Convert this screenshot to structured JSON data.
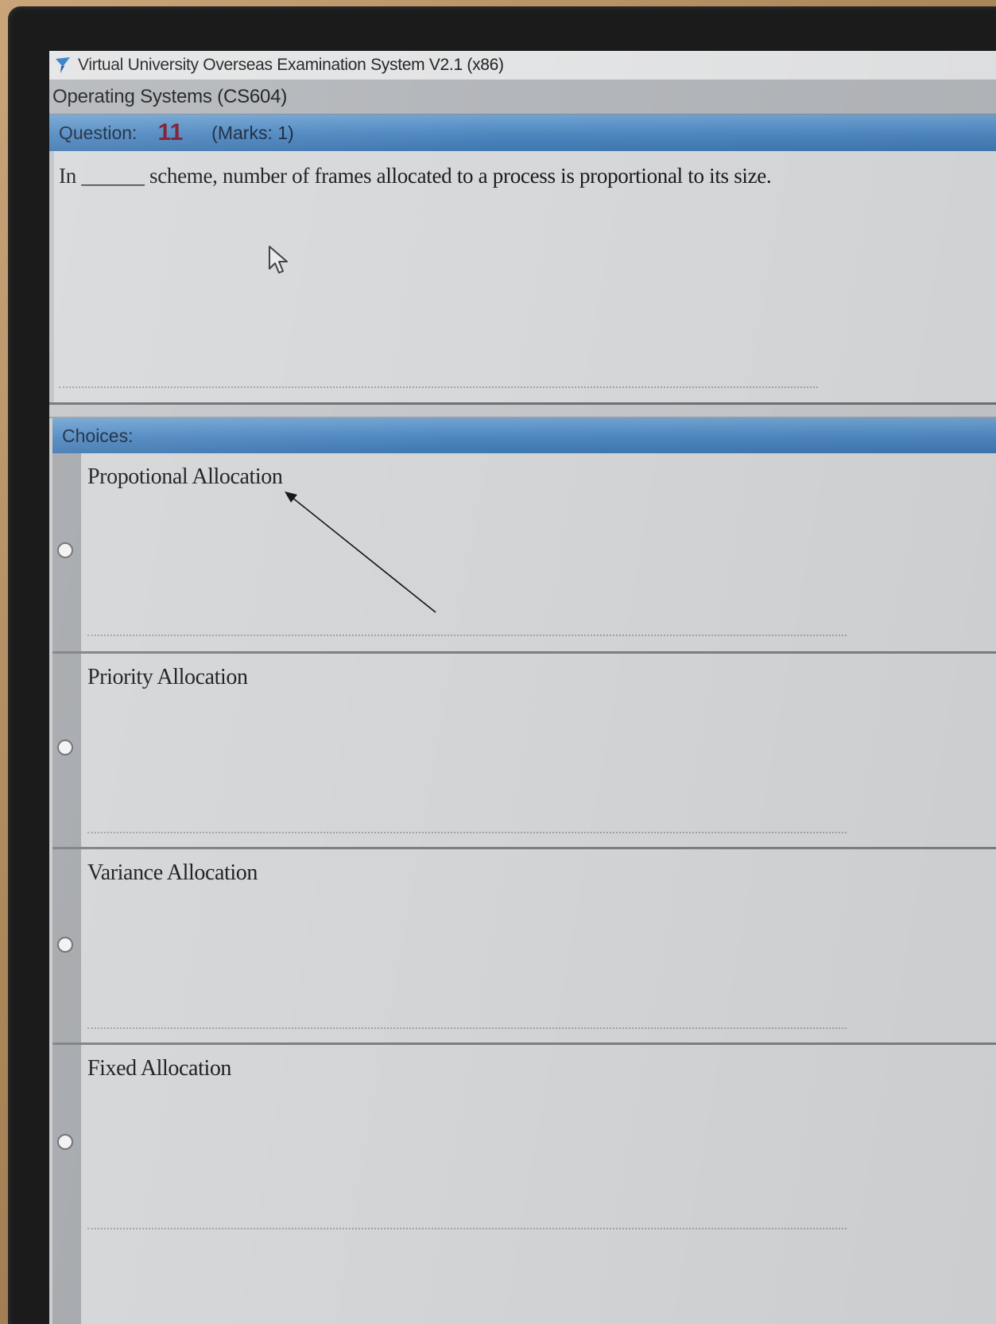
{
  "window": {
    "title": "Virtual University Overseas Examination System  V2.1 (x86)",
    "logo_icon": "vu-logo-icon"
  },
  "course": {
    "title": "Operating Systems  (CS604)"
  },
  "question": {
    "label": "Question:",
    "number": "11",
    "marks": "(Marks: 1)",
    "text": "In ______ scheme, number of frames allocated to a process is proportional to its size."
  },
  "choices": {
    "header": "Choices:",
    "options": [
      {
        "label": "Propotional Allocation"
      },
      {
        "label": "Priority Allocation"
      },
      {
        "label": "Variance Allocation"
      },
      {
        "label": "Fixed Allocation"
      }
    ]
  },
  "colors": {
    "header_blue": "#4d86bf",
    "question_number": "#7a1528",
    "panel_gray": "#d3d5d7"
  }
}
